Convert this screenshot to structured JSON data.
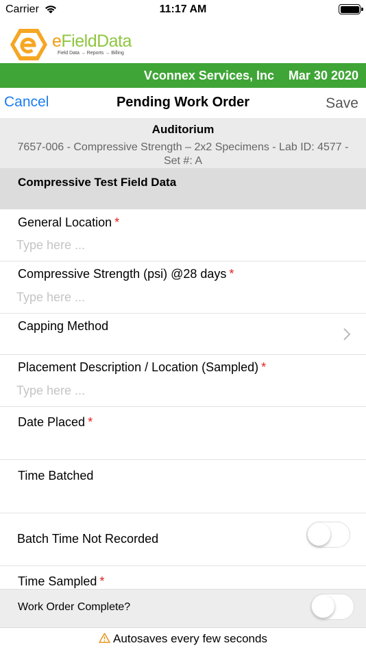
{
  "status_bar": {
    "carrier": "Carrier",
    "time": "11:17 AM",
    "battery_level": 1.0
  },
  "logo": {
    "brand_e": "e",
    "brand_rest": "FieldData",
    "tagline": "Field Data → Reports → Billing"
  },
  "header": {
    "company": "Vconnex Services, Inc",
    "date": "Mar 30 2020"
  },
  "nav": {
    "cancel_label": "Cancel",
    "title": "Pending Work Order",
    "save_label": "Save"
  },
  "project": {
    "name": "Auditorium",
    "description": "7657-006 - Compressive Strength – 2x2 Specimens - Lab ID: 4577  - Set #: A"
  },
  "section": {
    "title": "Compressive Test Field Data"
  },
  "form": {
    "required_mark": "*",
    "placeholder": "Type here ...",
    "general_location": "General Location",
    "compressive_strength": "Compressive Strength (psi) @28 days",
    "capping_method": "Capping Method",
    "placement_description": "Placement Description / Location (Sampled)",
    "date_placed": "Date Placed",
    "time_batched": "Time Batched",
    "batch_time_not_recorded": "Batch Time Not Recorded",
    "time_sampled": "Time Sampled"
  },
  "toggles": {
    "batch_time_not_recorded": false,
    "work_order_complete": false
  },
  "footer": {
    "work_order_complete": "Work Order Complete?",
    "autosave": "Autosaves every few seconds"
  },
  "colors": {
    "brand_green": "#3fa537",
    "ios_blue": "#1a7cf2",
    "required_red": "#e0201b",
    "logo_orange": "#f39c12"
  },
  "icons": [
    "wifi-icon",
    "battery-icon",
    "logo-hex-icon",
    "chevron-right-icon",
    "warning-icon"
  ]
}
